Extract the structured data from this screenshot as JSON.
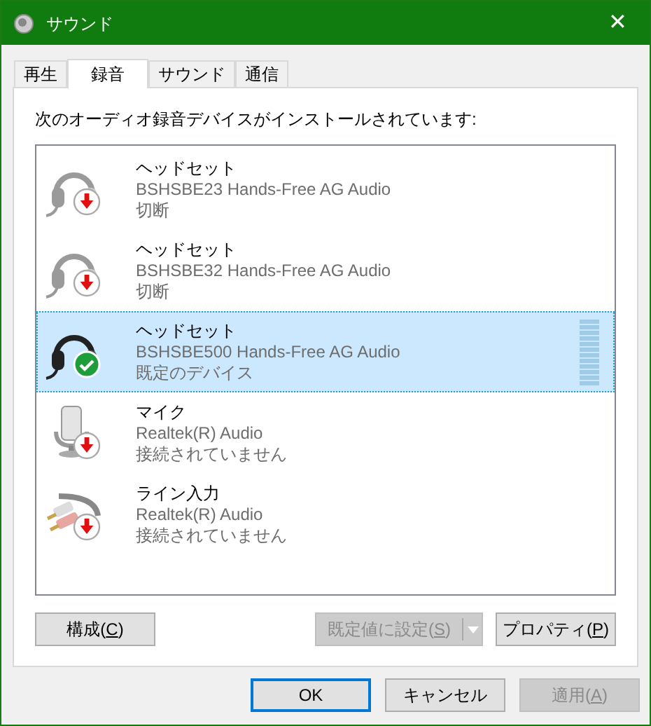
{
  "window": {
    "title": "サウンド",
    "close": "✕"
  },
  "tabs": [
    {
      "label": "再生",
      "selected": false
    },
    {
      "label": "録音",
      "selected": true
    },
    {
      "label": "サウンド",
      "selected": false
    },
    {
      "label": "通信",
      "selected": false
    }
  ],
  "intro": "次のオーディオ録音デバイスがインストールされています:",
  "devices": [
    {
      "kind": "headset",
      "name": "ヘッドセット",
      "driver": "BSHSBE23 Hands-Free AG Audio",
      "status": "切断",
      "is_default": false,
      "selected": false
    },
    {
      "kind": "headset",
      "name": "ヘッドセット",
      "driver": "BSHSBE32 Hands-Free AG Audio",
      "status": "切断",
      "is_default": false,
      "selected": false
    },
    {
      "kind": "headset",
      "name": "ヘッドセット",
      "driver": "BSHSBE500 Hands-Free AG Audio",
      "status": "既定のデバイス",
      "is_default": true,
      "selected": true,
      "meter": true
    },
    {
      "kind": "mic",
      "name": "マイク",
      "driver": "Realtek(R) Audio",
      "status": "接続されていません",
      "is_default": false,
      "selected": false
    },
    {
      "kind": "line",
      "name": "ライン入力",
      "driver": "Realtek(R) Audio",
      "status": "接続されていません",
      "is_default": false,
      "selected": false
    }
  ],
  "panel_buttons": [
    {
      "kind": "plain",
      "before": "構成(",
      "key": "C",
      "after": ")",
      "disabled": false
    },
    {
      "kind": "split",
      "before": "既定値に設定(",
      "key": "S",
      "after": ")",
      "disabled": true
    },
    {
      "kind": "plain",
      "before": "プロパティ(",
      "key": "P",
      "after": ")",
      "disabled": false
    }
  ],
  "dialog_buttons": [
    {
      "before": "OK",
      "disabled": false,
      "default": true
    },
    {
      "before": "キャンセル",
      "disabled": false,
      "default": false
    },
    {
      "before": "適用(",
      "key": "A",
      "after": ")",
      "disabled": true,
      "default": false
    }
  ]
}
